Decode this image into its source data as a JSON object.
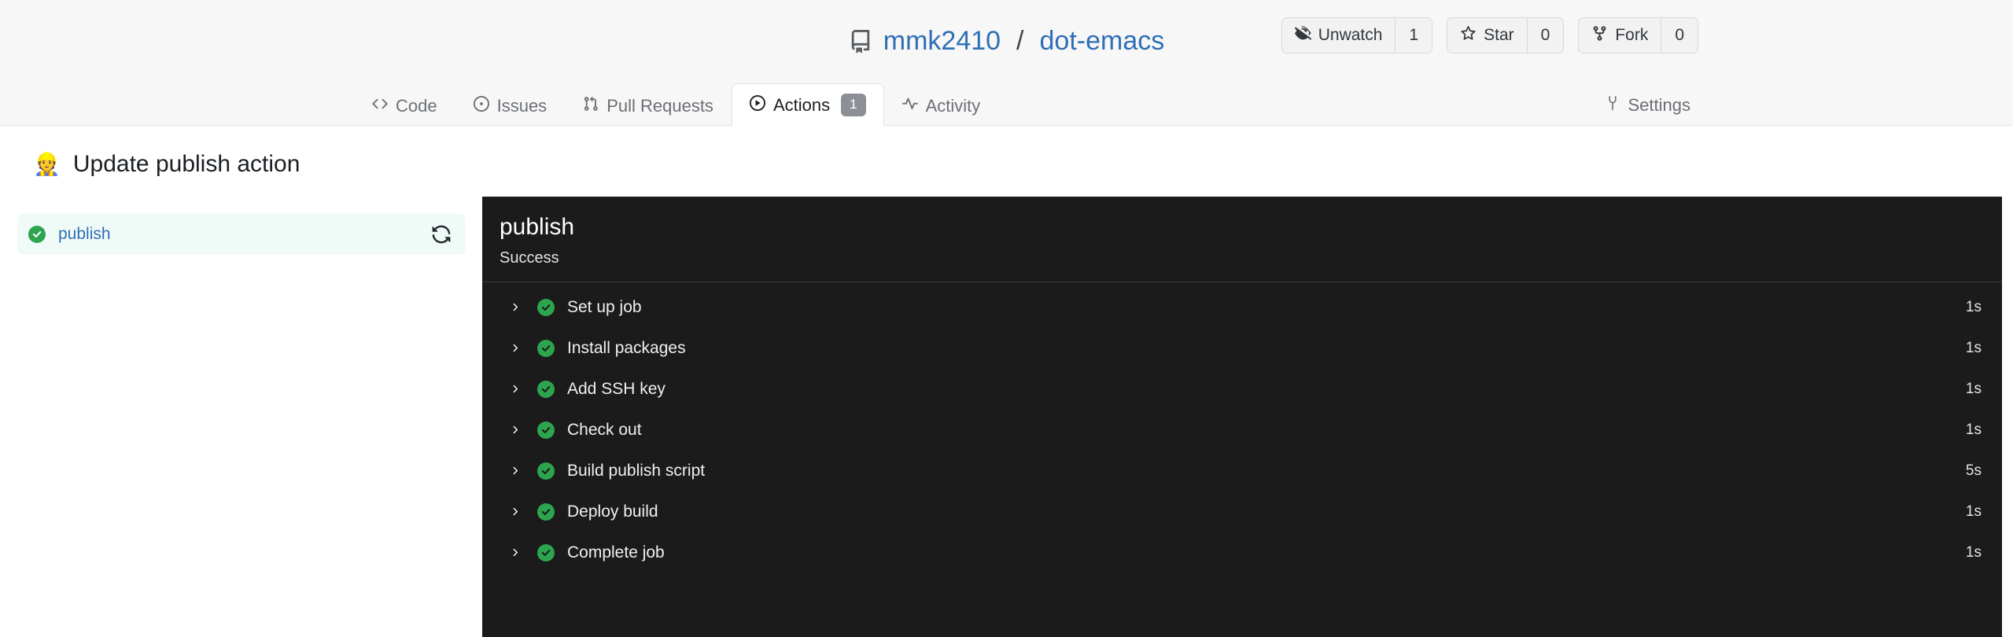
{
  "repo": {
    "icon": "repo-book-icon",
    "owner": "mmk2410",
    "separator": "/",
    "name": "dot-emacs"
  },
  "repo_actions": [
    {
      "icon": "eye-closed-icon",
      "label": "Unwatch",
      "count": "1"
    },
    {
      "icon": "star-icon",
      "label": "Star",
      "count": "0"
    },
    {
      "icon": "repo-forked-icon",
      "label": "Fork",
      "count": "0"
    }
  ],
  "nav": {
    "tabs": [
      {
        "icon": "code-icon",
        "label": "Code",
        "active": false,
        "badge": null
      },
      {
        "icon": "issue-opened-icon",
        "label": "Issues",
        "active": false,
        "badge": null
      },
      {
        "icon": "git-pull-request-icon",
        "label": "Pull Requests",
        "active": false,
        "badge": null
      },
      {
        "icon": "play-circle-icon",
        "label": "Actions",
        "active": true,
        "badge": "1"
      },
      {
        "icon": "pulse-icon",
        "label": "Activity",
        "active": false,
        "badge": null
      }
    ],
    "settings": {
      "icon": "tools-icon",
      "label": "Settings"
    }
  },
  "run": {
    "emoji": "👷",
    "title": "Update publish action"
  },
  "jobs": [
    {
      "status_icon": "check-circle-fill-icon",
      "name": "publish",
      "rerun_icon": "sync-icon",
      "selected": true
    }
  ],
  "log": {
    "title": "publish",
    "status": "Success",
    "steps": [
      {
        "chevron": "chevron-right-icon",
        "status_icon": "check-circle-fill-icon",
        "name": "Set up job",
        "duration": "1s"
      },
      {
        "chevron": "chevron-right-icon",
        "status_icon": "check-circle-fill-icon",
        "name": "Install packages",
        "duration": "1s"
      },
      {
        "chevron": "chevron-right-icon",
        "status_icon": "check-circle-fill-icon",
        "name": "Add SSH key",
        "duration": "1s"
      },
      {
        "chevron": "chevron-right-icon",
        "status_icon": "check-circle-fill-icon",
        "name": "Check out",
        "duration": "1s"
      },
      {
        "chevron": "chevron-right-icon",
        "status_icon": "check-circle-fill-icon",
        "name": "Build publish script",
        "duration": "5s"
      },
      {
        "chevron": "chevron-right-icon",
        "status_icon": "check-circle-fill-icon",
        "name": "Deploy build",
        "duration": "1s"
      },
      {
        "chevron": "chevron-right-icon",
        "status_icon": "check-circle-fill-icon",
        "name": "Complete job",
        "duration": "1s"
      }
    ]
  },
  "colors": {
    "link": "#2f6fb5",
    "success": "#2da44e",
    "panel_bg": "#1b1b1b",
    "header_bg": "#f7f7f7",
    "job_selected_bg": "#f0fbf8",
    "badge_bg": "#8c9096"
  }
}
